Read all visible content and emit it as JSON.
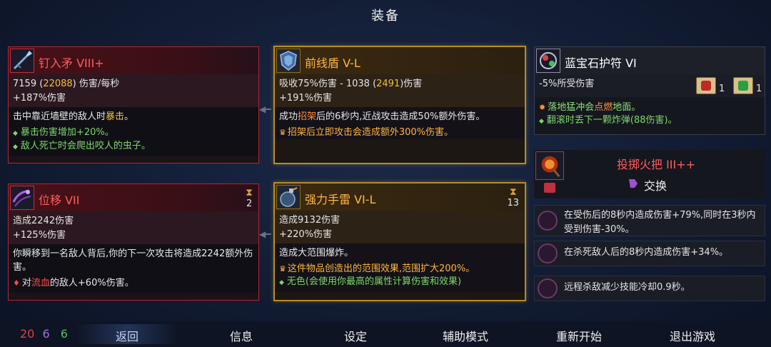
{
  "header": {
    "title": "装备"
  },
  "weapon1": {
    "name": "钉入矛 VIII+",
    "dps": "7159",
    "dps_crit": "22088",
    "dps_unit": "伤害/每秒",
    "bonus": "+187%伤害",
    "desc_pre": "击中靠近墙壁的敌人时",
    "desc_kw": "暴击",
    "desc_post": "。",
    "perk1": "暴击伤害增加+20%。",
    "perk2": "敌人死亡时会爬出咬人的虫子。"
  },
  "weapon2": {
    "name": "前线盾 V-L",
    "stat_pre": "吸收75%伤害 - 1038 (",
    "stat_hi": "2491",
    "stat_post": ")伤害",
    "bonus": "+191%伤害",
    "desc_pre": "成功",
    "desc_kw": "招架",
    "desc_post": "后的6秒内,近战攻击造成50%额外伤害。",
    "perk": "招架后立即攻击会造成额外300%伤害。"
  },
  "skill1": {
    "name": "位移 VII",
    "cooldown": "2",
    "damage": "造成2242伤害",
    "bonus": "+125%伤害",
    "desc": "你瞬移到一名敌人背后,你的下一次攻击将造成2242额外伤害。",
    "perk_pre": "对",
    "perk_kw": "流血",
    "perk_post": "的敌人+60%伤害。"
  },
  "skill2": {
    "name": "强力手雷 VI-L",
    "cooldown": "13",
    "damage": "造成9132伤害",
    "bonus": "+220%伤害",
    "desc": "造成大范围爆炸。",
    "perk1": "这件物品创造出的范围效果,范围扩大200%。",
    "perk2": "无色(会使用你最高的属性计算伤害和效果)"
  },
  "amulet": {
    "name": "蓝宝石护符 VI",
    "stat": "-5%所受伤害",
    "scroll1_count": "1",
    "scroll2_count": "1",
    "perk1_pre": "落地猛冲会",
    "perk1_kw": "点燃",
    "perk1_post": "地面。",
    "perk2": "翻滚时丢下一颗炸弹(88伤害)。"
  },
  "backpack": {
    "name": "投掷火把 III++",
    "swap": "交换"
  },
  "mutations": [
    {
      "text": "在受伤后的8秒内造成伤害+79%,同时在3秒内受到伤害-30%。"
    },
    {
      "text": "在杀死敌人后的8秒内造成伤害+34%。"
    },
    {
      "text": "远程杀敌减少技能冷却0.9秒。"
    }
  ],
  "stats": {
    "brutality": "20",
    "tactics": "6",
    "survival": "6"
  },
  "colors": {
    "brutality": "#e04040",
    "tactics": "#a070e0",
    "survival": "#50c060"
  },
  "nav": {
    "back": "返回",
    "info": "信息",
    "settings": "设定",
    "assist": "辅助模式",
    "restart": "重新开始",
    "quit": "退出游戏"
  }
}
